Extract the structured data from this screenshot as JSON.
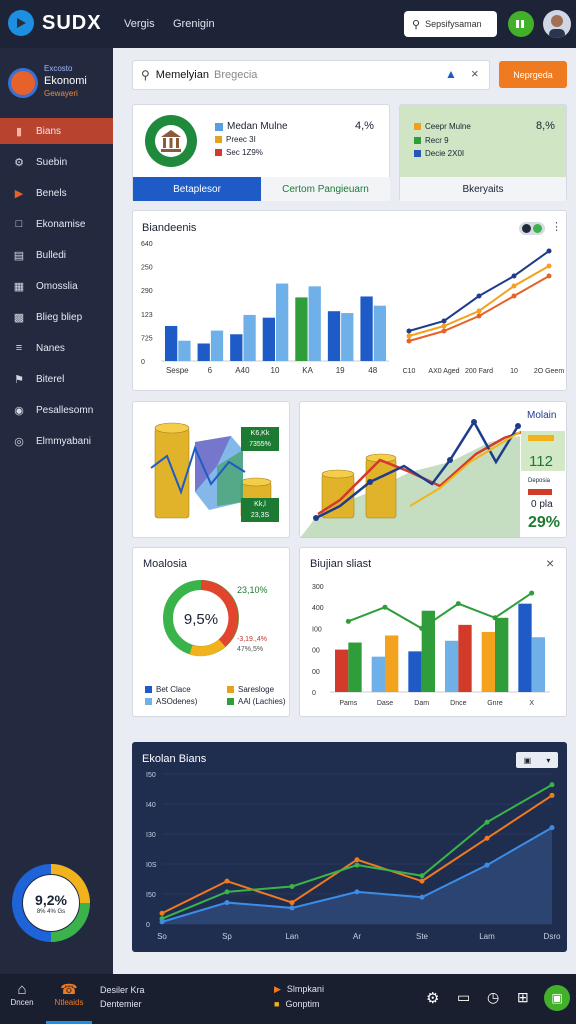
{
  "app": {
    "name": "SUDX",
    "nav": [
      "Vergis",
      "Grenigin"
    ],
    "search_label": "Sepsifysaman"
  },
  "sidebar": {
    "header": [
      "Excosto",
      "Ekonomi",
      "Gewayeri"
    ],
    "items": [
      {
        "label": "Bians",
        "icon": "bookmark-icon",
        "active": true
      },
      {
        "label": "Suebin",
        "icon": "gear-icon"
      },
      {
        "label": "Benels",
        "icon": "play-icon"
      },
      {
        "label": "Ekonamise",
        "icon": "chat-icon"
      },
      {
        "label": "Bulledi",
        "icon": "list-icon"
      },
      {
        "label": "Omosslia",
        "icon": "building-icon"
      },
      {
        "label": "Blieg bliep",
        "icon": "truck-icon"
      },
      {
        "label": "Nanes",
        "icon": "menu-icon"
      },
      {
        "label": "Biterel",
        "icon": "flag-icon"
      },
      {
        "label": "Pesallesomn",
        "icon": "pin-icon"
      },
      {
        "label": "Elmmyabani",
        "icon": "target-icon"
      }
    ],
    "gauge": {
      "label": "9,2%",
      "sub": "8% 4% Gs",
      "value": 0.92
    }
  },
  "search": {
    "value": "Memelyian",
    "placeholder": "Bregecia",
    "button": "Neprgeda"
  },
  "card1": {
    "items": [
      {
        "label": "Medan Mulne",
        "color": "#5aa0e0"
      },
      {
        "label": "Preec 3I",
        "color": "#e3a21a"
      },
      {
        "label": "Sec 1Z9%",
        "color": "#d23a2a"
      }
    ],
    "value": "4,%",
    "tabs": [
      "Betaplesor",
      "Certom Pangieuarn"
    ]
  },
  "card2": {
    "items": [
      {
        "label": "Ceepr Mulne",
        "color": "#f0a01c"
      },
      {
        "label": "Recr 9",
        "color": "#2f9d3a"
      },
      {
        "label": "Decie 2X0I",
        "color": "#2a55b5"
      }
    ],
    "value": "8,%",
    "tab": "Bkeryaits"
  },
  "chart1": {
    "title": "Biandeenis",
    "y_ticks": [
      "640",
      "250",
      "290",
      "123",
      "725",
      "0"
    ],
    "x_ticks": [
      "Sespe",
      "6",
      "A40",
      "10",
      "KA",
      "19",
      "48"
    ],
    "line_x_ticks": [
      "C10",
      "AX0 Aged",
      "200 Fard",
      "10",
      "2O Geem"
    ]
  },
  "card_coins": {
    "badge1": [
      "K6,Kk",
      "7355%"
    ],
    "badge2": [
      "Kk,l",
      "23,3S"
    ]
  },
  "card_growth": {
    "title": "Molain",
    "val1": "112",
    "label2": "Deposia",
    "val2": "0 pla",
    "val3": "29%"
  },
  "donut_card": {
    "title": "Moalosia",
    "pct_top": "23,10%",
    "center": "9,5%",
    "pct_side": [
      "-3,19.,4%",
      "47%,5%"
    ],
    "legend": [
      {
        "label": "Bet Clace",
        "color": "#1e5bc6"
      },
      {
        "label": "Saresloge",
        "color": "#e6a21a"
      },
      {
        "label": "ASOdenes)",
        "color": "#6fb0e8"
      },
      {
        "label": "AAl (Lachies)",
        "color": "#2f9d3a"
      }
    ]
  },
  "chart2": {
    "title": "Biujian sliast",
    "y_ticks": [
      "300",
      "400",
      "I00",
      "00",
      "00",
      "0"
    ],
    "x_ticks": [
      "Pams",
      "Dase",
      "Dam",
      "Dnce",
      "Gnre",
      "X"
    ]
  },
  "chart3": {
    "title": "Ekolan Bians",
    "y_ticks": [
      "I50",
      "I40",
      "I30",
      "I0S",
      "I50",
      "0"
    ],
    "x_ticks": [
      "So",
      "Sp",
      "Lan",
      "Ar",
      "Ste",
      "Lam",
      "Dsro"
    ]
  },
  "bottom": {
    "home": "Dncen",
    "alert": "Ntleaids",
    "text1": "Desiler Kra",
    "text2": "Dentemier",
    "link1": "Slmpkani",
    "link2": "Gonptim"
  },
  "chart_data": [
    {
      "type": "bar",
      "title": "Biandeenis",
      "categories": [
        "Sespe",
        "6",
        "A40",
        "10",
        "KA",
        "19",
        "48"
      ],
      "series": [
        {
          "values": [
            190,
            95,
            145,
            235,
            345,
            270,
            350
          ]
        },
        {
          "values": [
            110,
            165,
            250,
            420,
            405,
            260,
            300
          ]
        }
      ],
      "ylim": [
        0,
        640
      ]
    },
    {
      "type": "line",
      "categories": [
        "C10",
        "AX0 Aged",
        "200 Fard",
        "10",
        "2O Geem"
      ],
      "series": [
        {
          "values": [
            20,
            30,
            55,
            75,
            100
          ]
        },
        {
          "values": [
            15,
            25,
            40,
            65,
            85
          ]
        },
        {
          "values": [
            10,
            20,
            35,
            55,
            75
          ]
        }
      ]
    },
    {
      "type": "bar",
      "title": "Biujian sliast",
      "categories": [
        "Pams",
        "Dase",
        "Dam",
        "Dnce",
        "Gnre",
        "X"
      ],
      "series": [
        {
          "values": [
            120,
            100,
            115,
            145,
            170,
            250
          ]
        },
        {
          "values": [
            140,
            160,
            230,
            190,
            210,
            155
          ]
        }
      ],
      "line": [
        200,
        240,
        180,
        250,
        210,
        280
      ]
    },
    {
      "type": "line",
      "title": "Ekolan Bians",
      "categories": [
        "So",
        "Sp",
        "Lan",
        "Ar",
        "Ste",
        "Lam",
        "Dsro"
      ],
      "series": [
        {
          "name": "",
          "values": [
            10,
            40,
            20,
            60,
            40,
            80,
            120
          ]
        },
        {
          "values": [
            5,
            30,
            35,
            55,
            45,
            95,
            130
          ]
        },
        {
          "values": [
            2,
            20,
            15,
            30,
            25,
            55,
            90
          ]
        }
      ]
    }
  ]
}
